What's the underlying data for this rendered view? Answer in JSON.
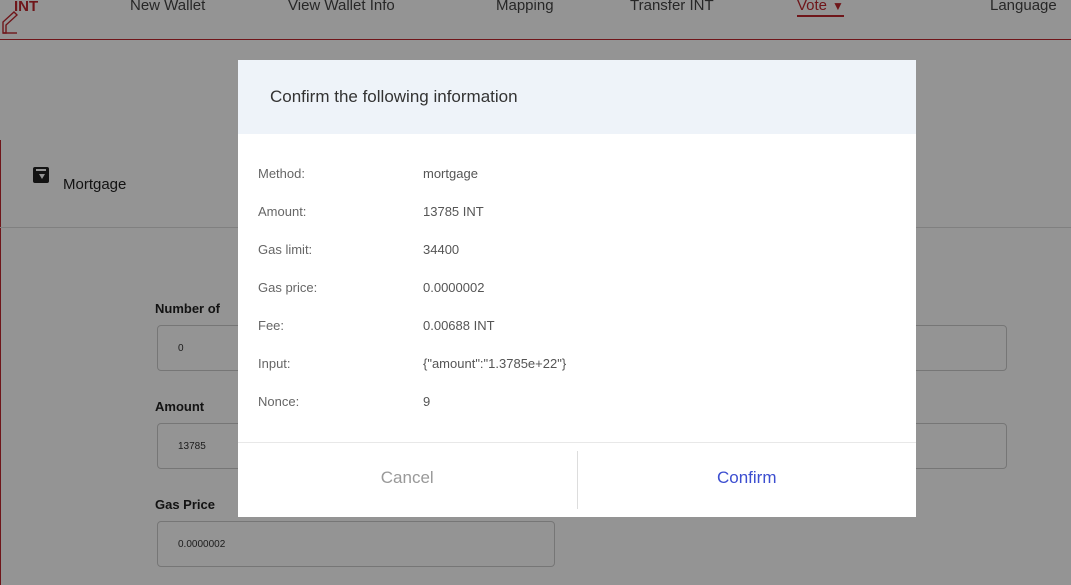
{
  "nav": {
    "logo_text": "INT",
    "items": [
      {
        "label": "New Wallet"
      },
      {
        "label": "View Wallet Info"
      },
      {
        "label": "Mapping"
      },
      {
        "label": "Transfer INT"
      },
      {
        "label": "Vote",
        "caret": "▼",
        "active": true
      },
      {
        "label": "Language"
      }
    ],
    "accent_color": "#c0262d"
  },
  "panel": {
    "icon": "download-box-icon",
    "title": "Mortgage"
  },
  "form": {
    "fields": [
      {
        "label": "Number of",
        "value": "0"
      },
      {
        "label": "Amount",
        "value": "13785"
      },
      {
        "label": "Gas Price",
        "value": "0.0000002"
      }
    ]
  },
  "modal": {
    "title": "Confirm the following information",
    "rows": [
      {
        "key": "Method:",
        "value": "mortgage"
      },
      {
        "key": "Amount:",
        "value": "13785 INT"
      },
      {
        "key": "Gas limit:",
        "value": "34400"
      },
      {
        "key": "Gas price:",
        "value": "0.0000002"
      },
      {
        "key": "Fee:",
        "value": "0.00688 INT"
      },
      {
        "key": "Input:",
        "value": "{\"amount\":\"1.3785e+22\"}"
      },
      {
        "key": "Nonce:",
        "value": "9"
      }
    ],
    "cancel_label": "Cancel",
    "confirm_label": "Confirm",
    "confirm_color": "#3c4ed0"
  }
}
